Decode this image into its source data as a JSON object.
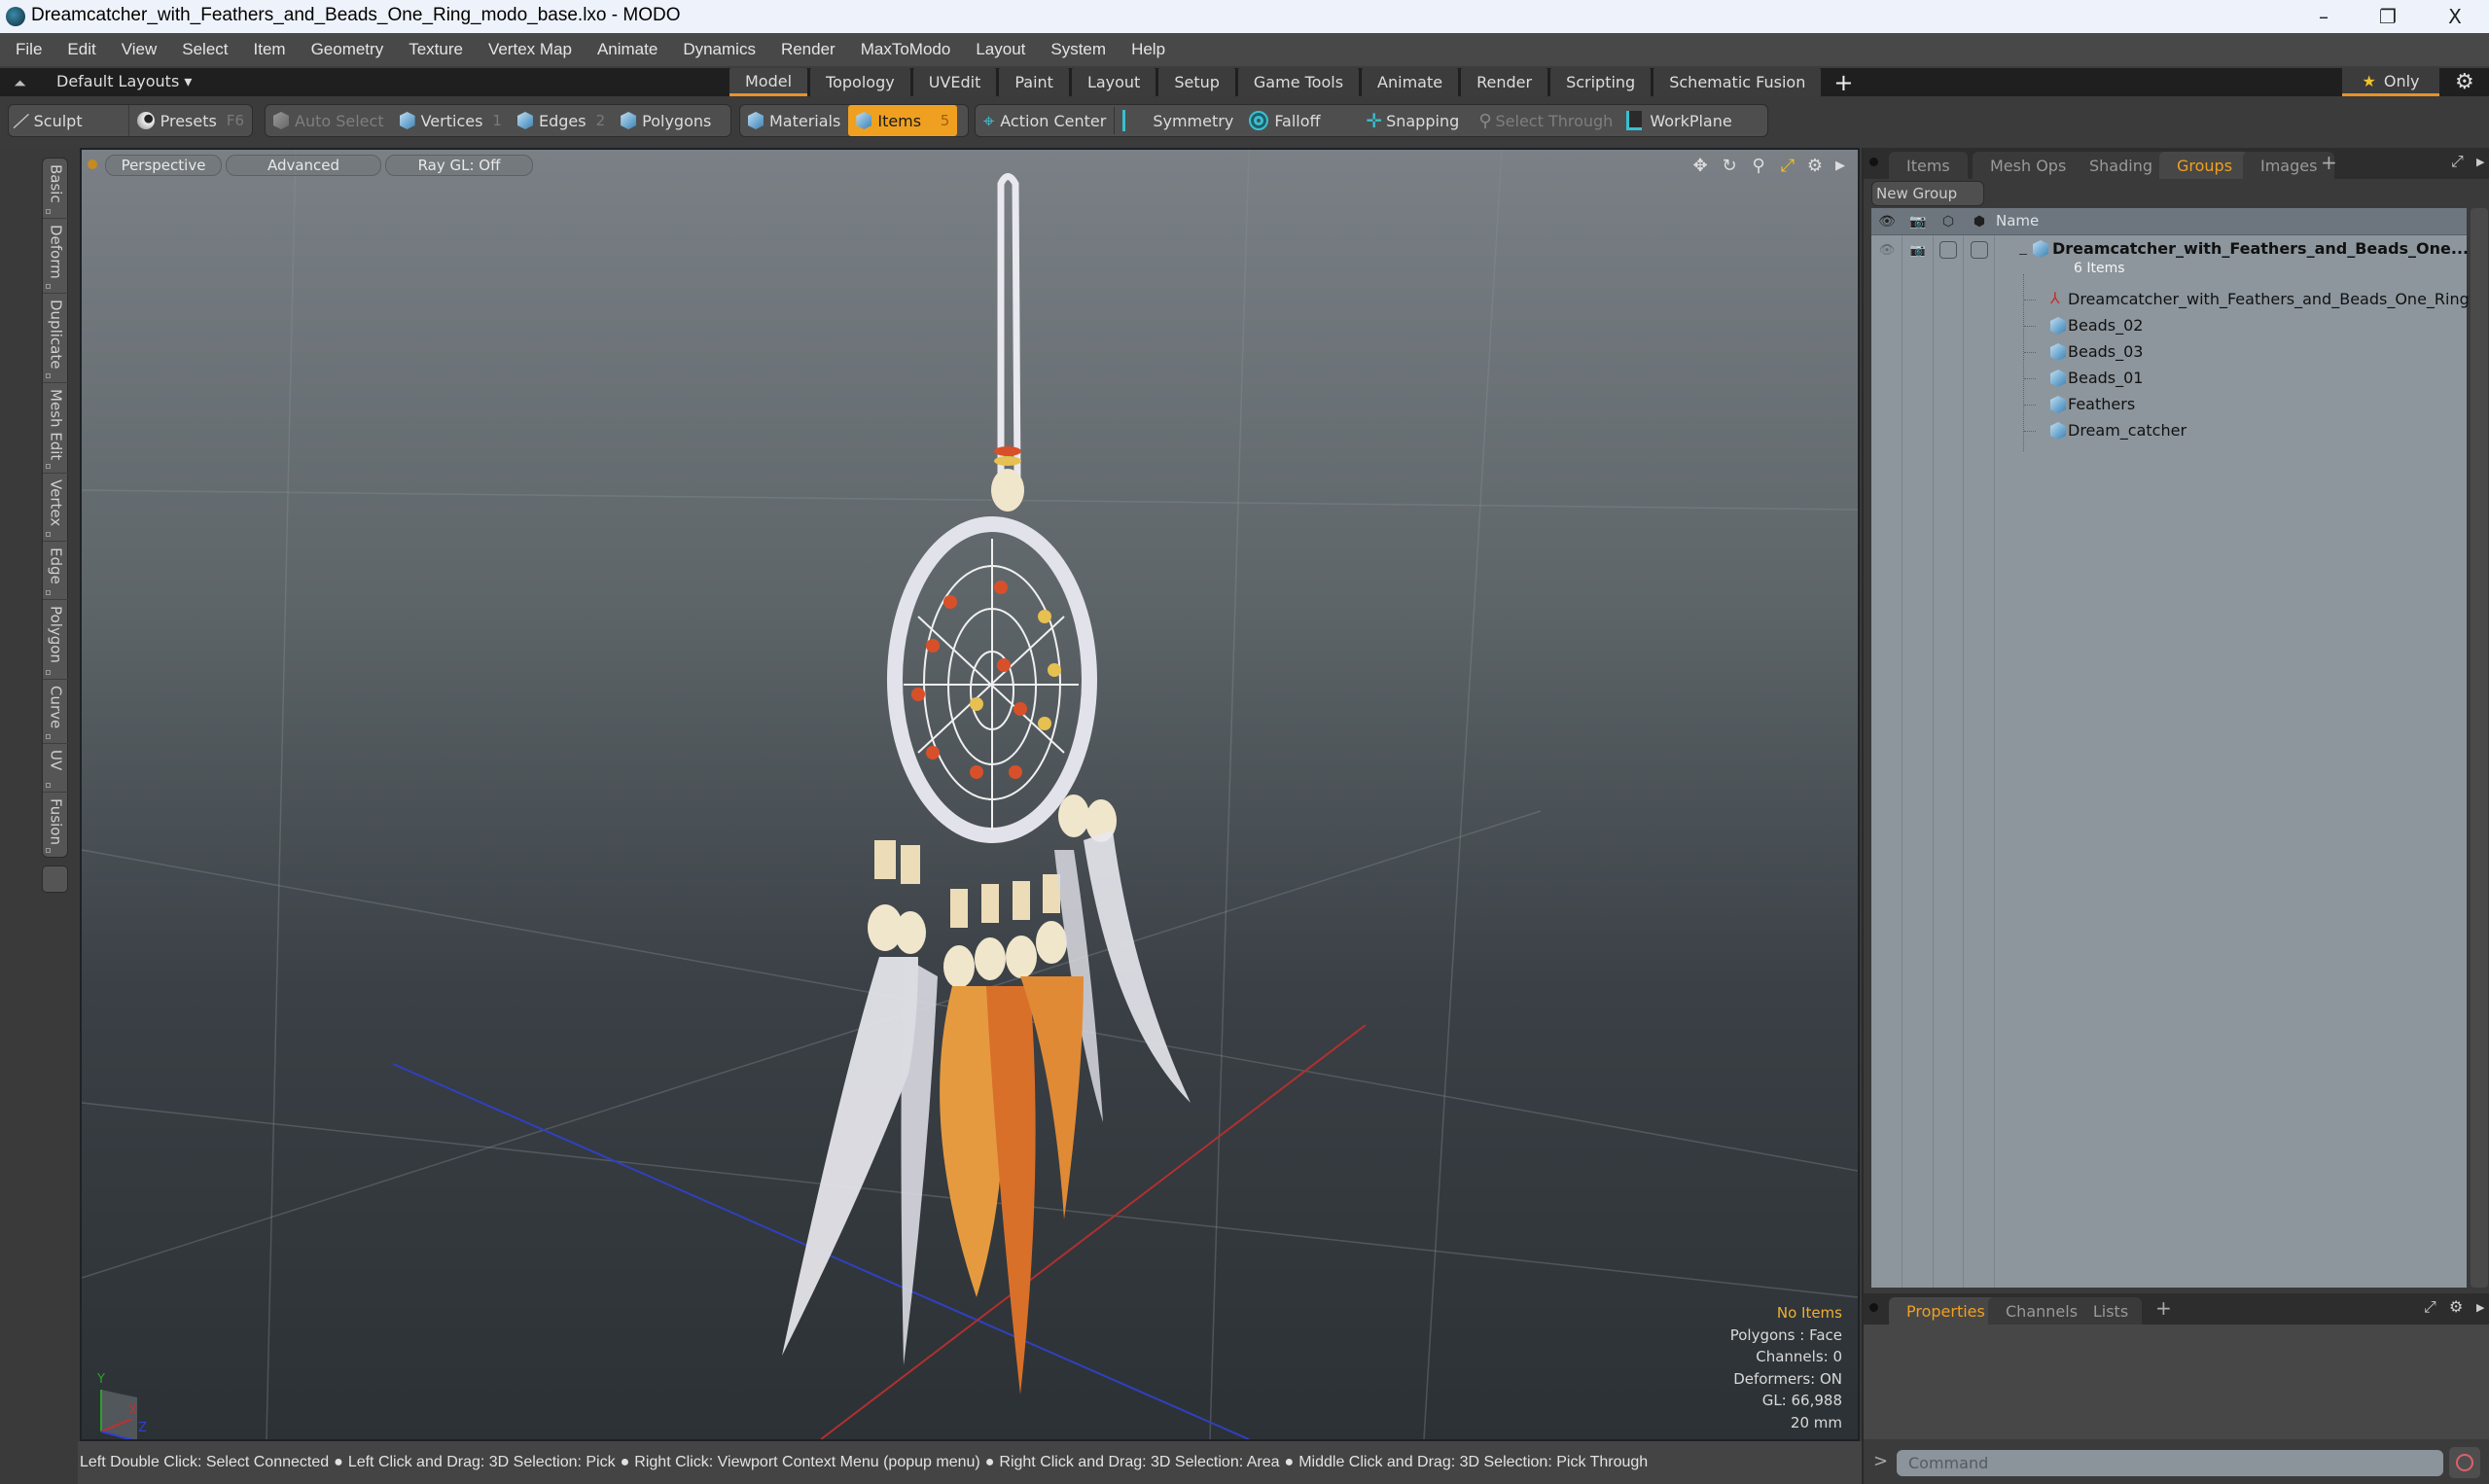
{
  "window": {
    "title": "Dreamcatcher_with_Feathers_and_Beads_One_Ring_modo_base.lxo - MODO",
    "controls": [
      "–",
      "❐",
      "X"
    ]
  },
  "menu": [
    "File",
    "Edit",
    "View",
    "Select",
    "Item",
    "Geometry",
    "Texture",
    "Vertex Map",
    "Animate",
    "Dynamics",
    "Render",
    "MaxToModo",
    "Layout",
    "System",
    "Help"
  ],
  "layoutbar": {
    "layouts_label": "Default Layouts ▾",
    "tabs": [
      "Model",
      "Topology",
      "UVEdit",
      "Paint",
      "Layout",
      "Setup",
      "Game Tools",
      "Animate",
      "Render",
      "Scripting",
      "Schematic Fusion"
    ],
    "active_tab": "Model",
    "add_label": "+",
    "only_label": "Only"
  },
  "toolbar": {
    "sculpt": "Sculpt",
    "presets": "Presets",
    "presets_key": "F6",
    "auto_select": "Auto Select",
    "vertices": "Vertices",
    "vertices_key": "1",
    "edges": "Edges",
    "edges_key": "2",
    "polygons": "Polygons",
    "materials": "Materials",
    "items": "Items",
    "items_key": "5",
    "action_center": "Action Center",
    "symmetry": "Symmetry",
    "falloff": "Falloff",
    "snapping": "Snapping",
    "select_through": "Select Through",
    "workplane": "WorkPlane"
  },
  "left_tabs": [
    "Basic",
    "Deform",
    "Duplicate",
    "Mesh Edit",
    "Vertex",
    "Edge",
    "Polygon",
    "Curve",
    "UV",
    "Fusion"
  ],
  "viewport": {
    "view_mode": "Perspective",
    "shading": "Advanced",
    "raygl": "Ray GL: Off",
    "hud": {
      "selection": "No Items",
      "polygons": "Polygons : Face",
      "channels": "Channels: 0",
      "deformers": "Deformers: ON",
      "gl": "GL: 66,988",
      "scale": "20 mm"
    },
    "axis": {
      "x": "X",
      "y": "Y",
      "z": "Z"
    }
  },
  "statusbar": {
    "hints": [
      "Left Double Click: Select Connected",
      "Left Click and Drag: 3D Selection: Pick",
      "Right Click: Viewport Context Menu (popup menu)",
      "Right Click and Drag: 3D Selection: Area",
      "Middle Click and Drag: 3D Selection: Pick Through"
    ]
  },
  "right_panel": {
    "tabs": [
      "Items",
      "Mesh Ops",
      "Shading",
      "Groups",
      "Images"
    ],
    "active_tab": "Groups",
    "new_group": "New Group",
    "column_name": "Name",
    "group": {
      "name": "Dreamcatcher_with_Feathers_and_Beads_One...",
      "count": "6 Items"
    },
    "items": [
      {
        "name": "Dreamcatcher_with_Feathers_and_Beads_One_Ring",
        "icon": "locator-icon"
      },
      {
        "name": "Beads_02",
        "icon": "mesh-icon"
      },
      {
        "name": "Beads_03",
        "icon": "mesh-icon"
      },
      {
        "name": "Beads_01",
        "icon": "mesh-icon"
      },
      {
        "name": "Feathers",
        "icon": "mesh-icon"
      },
      {
        "name": "Dream_catcher",
        "icon": "mesh-icon"
      }
    ],
    "bottom_tabs": [
      "Properties",
      "Channels",
      "Lists"
    ],
    "bottom_active": "Properties",
    "command_placeholder": "Command"
  },
  "colors": {
    "accent": "#f0a020",
    "hud_warning": "#f0b030"
  }
}
